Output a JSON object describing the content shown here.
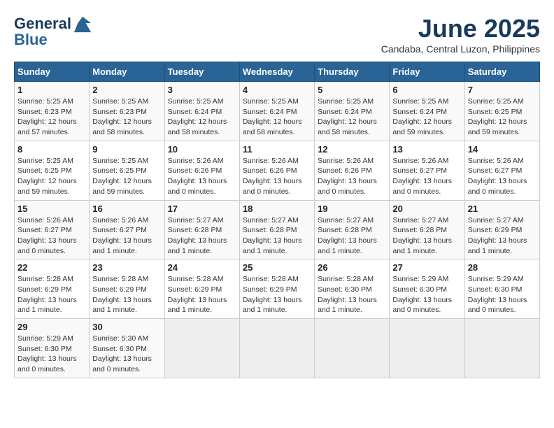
{
  "header": {
    "logo_line1": "General",
    "logo_line2": "Blue",
    "month_title": "June 2025",
    "location": "Candaba, Central Luzon, Philippines"
  },
  "weekdays": [
    "Sunday",
    "Monday",
    "Tuesday",
    "Wednesday",
    "Thursday",
    "Friday",
    "Saturday"
  ],
  "weeks": [
    [
      {
        "day": "1",
        "sunrise": "5:25 AM",
        "sunset": "6:23 PM",
        "daylight": "12 hours and 57 minutes."
      },
      {
        "day": "2",
        "sunrise": "5:25 AM",
        "sunset": "6:23 PM",
        "daylight": "12 hours and 58 minutes."
      },
      {
        "day": "3",
        "sunrise": "5:25 AM",
        "sunset": "6:24 PM",
        "daylight": "12 hours and 58 minutes."
      },
      {
        "day": "4",
        "sunrise": "5:25 AM",
        "sunset": "6:24 PM",
        "daylight": "12 hours and 58 minutes."
      },
      {
        "day": "5",
        "sunrise": "5:25 AM",
        "sunset": "6:24 PM",
        "daylight": "12 hours and 58 minutes."
      },
      {
        "day": "6",
        "sunrise": "5:25 AM",
        "sunset": "6:24 PM",
        "daylight": "12 hours and 59 minutes."
      },
      {
        "day": "7",
        "sunrise": "5:25 AM",
        "sunset": "6:25 PM",
        "daylight": "12 hours and 59 minutes."
      }
    ],
    [
      {
        "day": "8",
        "sunrise": "5:25 AM",
        "sunset": "6:25 PM",
        "daylight": "12 hours and 59 minutes."
      },
      {
        "day": "9",
        "sunrise": "5:25 AM",
        "sunset": "6:25 PM",
        "daylight": "12 hours and 59 minutes."
      },
      {
        "day": "10",
        "sunrise": "5:26 AM",
        "sunset": "6:26 PM",
        "daylight": "13 hours and 0 minutes."
      },
      {
        "day": "11",
        "sunrise": "5:26 AM",
        "sunset": "6:26 PM",
        "daylight": "13 hours and 0 minutes."
      },
      {
        "day": "12",
        "sunrise": "5:26 AM",
        "sunset": "6:26 PM",
        "daylight": "13 hours and 0 minutes."
      },
      {
        "day": "13",
        "sunrise": "5:26 AM",
        "sunset": "6:27 PM",
        "daylight": "13 hours and 0 minutes."
      },
      {
        "day": "14",
        "sunrise": "5:26 AM",
        "sunset": "6:27 PM",
        "daylight": "13 hours and 0 minutes."
      }
    ],
    [
      {
        "day": "15",
        "sunrise": "5:26 AM",
        "sunset": "6:27 PM",
        "daylight": "13 hours and 0 minutes."
      },
      {
        "day": "16",
        "sunrise": "5:26 AM",
        "sunset": "6:27 PM",
        "daylight": "13 hours and 1 minute."
      },
      {
        "day": "17",
        "sunrise": "5:27 AM",
        "sunset": "6:28 PM",
        "daylight": "13 hours and 1 minute."
      },
      {
        "day": "18",
        "sunrise": "5:27 AM",
        "sunset": "6:28 PM",
        "daylight": "13 hours and 1 minute."
      },
      {
        "day": "19",
        "sunrise": "5:27 AM",
        "sunset": "6:28 PM",
        "daylight": "13 hours and 1 minute."
      },
      {
        "day": "20",
        "sunrise": "5:27 AM",
        "sunset": "6:28 PM",
        "daylight": "13 hours and 1 minute."
      },
      {
        "day": "21",
        "sunrise": "5:27 AM",
        "sunset": "6:29 PM",
        "daylight": "13 hours and 1 minute."
      }
    ],
    [
      {
        "day": "22",
        "sunrise": "5:28 AM",
        "sunset": "6:29 PM",
        "daylight": "13 hours and 1 minute."
      },
      {
        "day": "23",
        "sunrise": "5:28 AM",
        "sunset": "6:29 PM",
        "daylight": "13 hours and 1 minute."
      },
      {
        "day": "24",
        "sunrise": "5:28 AM",
        "sunset": "6:29 PM",
        "daylight": "13 hours and 1 minute."
      },
      {
        "day": "25",
        "sunrise": "5:28 AM",
        "sunset": "6:29 PM",
        "daylight": "13 hours and 1 minute."
      },
      {
        "day": "26",
        "sunrise": "5:28 AM",
        "sunset": "6:30 PM",
        "daylight": "13 hours and 1 minute."
      },
      {
        "day": "27",
        "sunrise": "5:29 AM",
        "sunset": "6:30 PM",
        "daylight": "13 hours and 0 minutes."
      },
      {
        "day": "28",
        "sunrise": "5:29 AM",
        "sunset": "6:30 PM",
        "daylight": "13 hours and 0 minutes."
      }
    ],
    [
      {
        "day": "29",
        "sunrise": "5:29 AM",
        "sunset": "6:30 PM",
        "daylight": "13 hours and 0 minutes."
      },
      {
        "day": "30",
        "sunrise": "5:30 AM",
        "sunset": "6:30 PM",
        "daylight": "13 hours and 0 minutes."
      },
      null,
      null,
      null,
      null,
      null
    ]
  ]
}
